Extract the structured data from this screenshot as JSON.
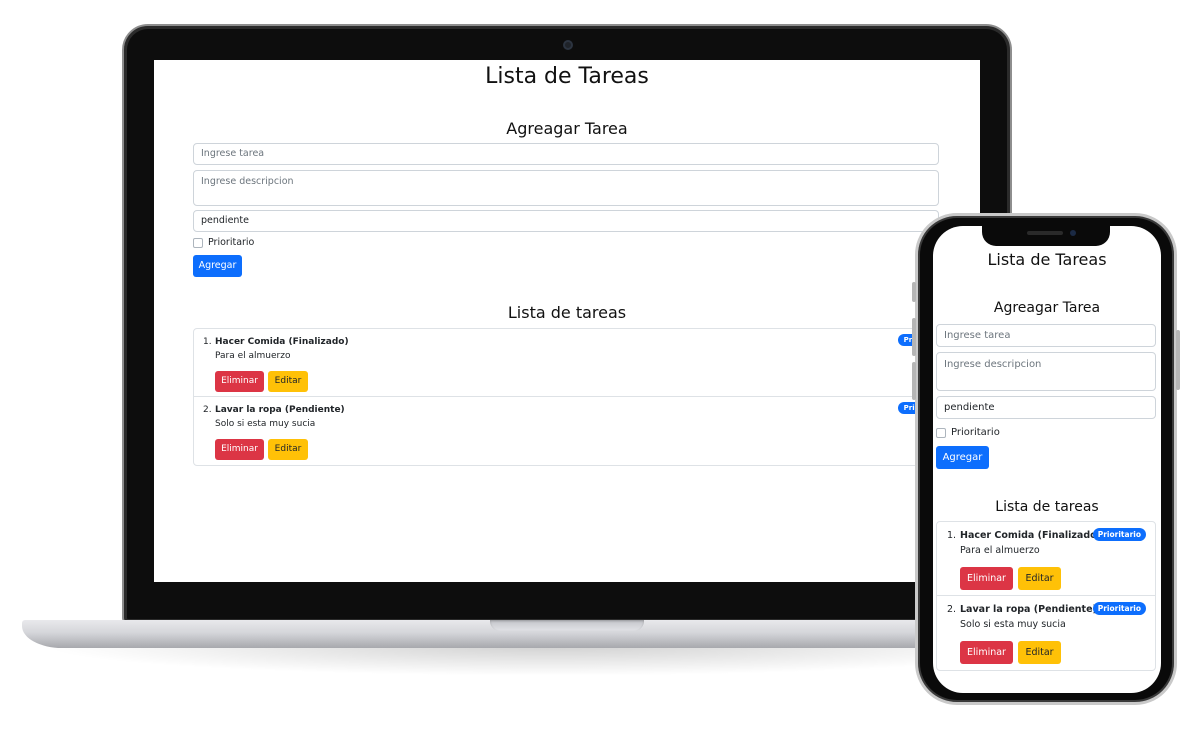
{
  "app": {
    "title": "Lista de Tareas",
    "form_title": "Agreagar Tarea",
    "task_placeholder": "Ingrese tarea",
    "description_placeholder": "Ingrese descripcion",
    "status_value": "pendiente",
    "priority_label": "Prioritario",
    "add_button": "Agregar",
    "list_title": "Lista de tareas",
    "delete_button": "Eliminar",
    "edit_button": "Editar",
    "tasks": [
      {
        "number": "1.",
        "name": "Hacer Comida (Finalizado)",
        "description": "Para el almuerzo",
        "badge": "Prioritario"
      },
      {
        "number": "2.",
        "name": "Lavar la ropa (Pendiente)",
        "description": "Solo si esta muy sucia",
        "badge": "Prioritario"
      }
    ]
  },
  "colors": {
    "primary": "#0d6efd",
    "danger": "#dc3545",
    "warning": "#ffc107",
    "device_frame": "#0d0d0d"
  }
}
